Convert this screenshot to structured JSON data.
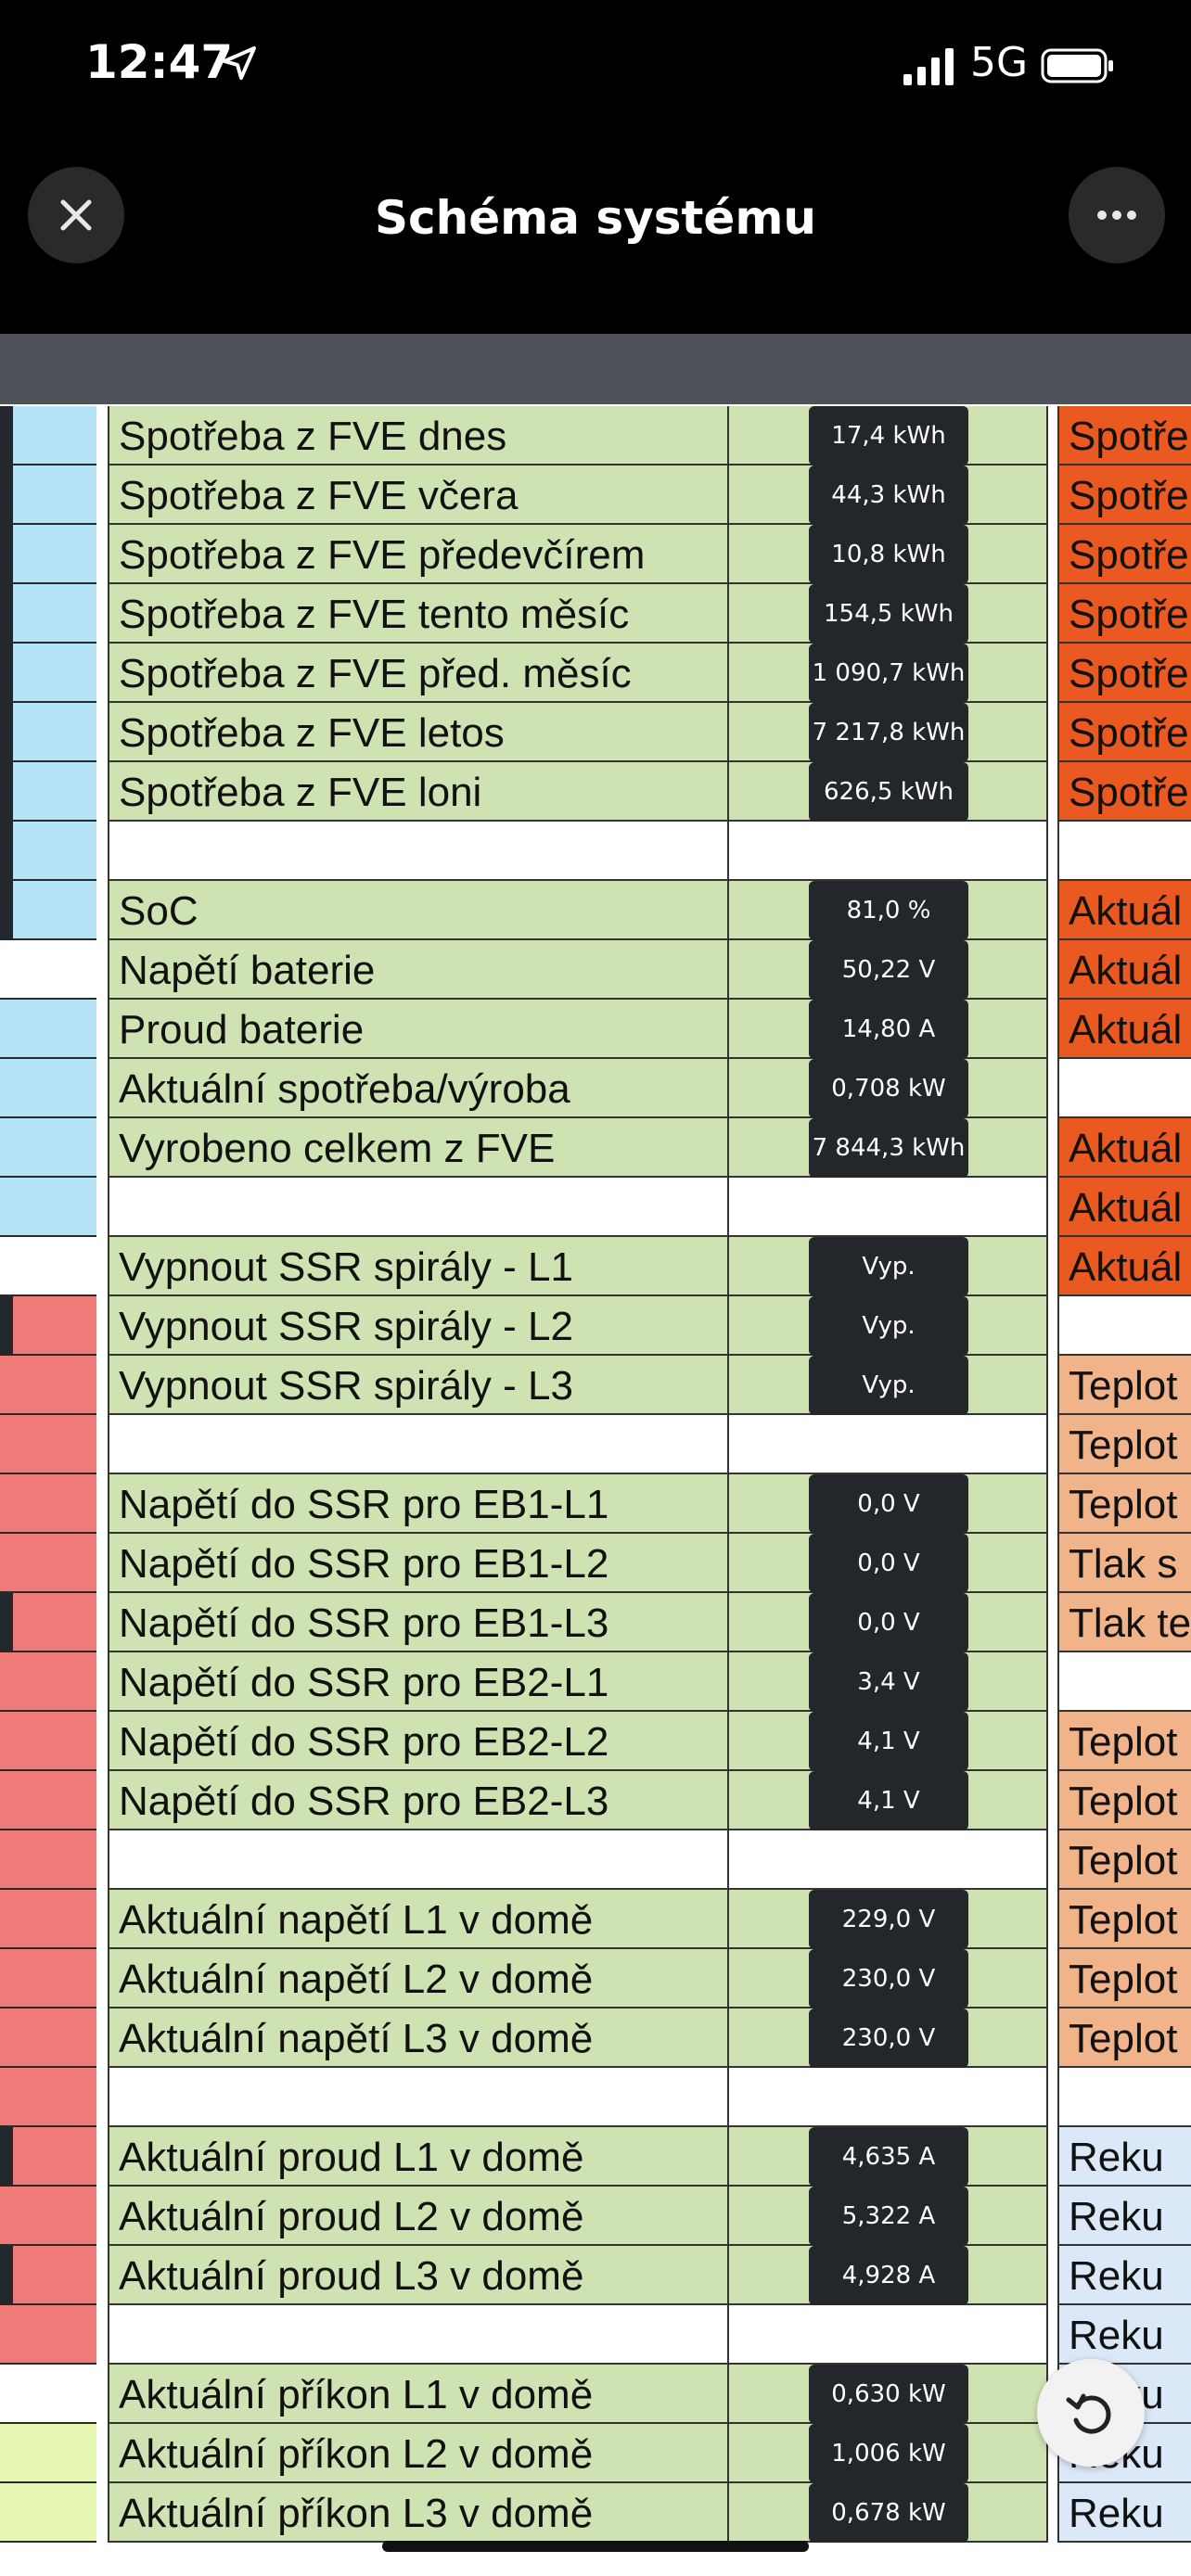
{
  "status_bar": {
    "time": "12:47",
    "network": "5G",
    "location_icon": "location-arrow-icon",
    "signal_icon": "cell-signal-icon",
    "battery_icon": "battery-icon"
  },
  "header": {
    "title": "Schéma systému",
    "close_icon": "close-icon",
    "more_icon": "more-dots-icon"
  },
  "table": {
    "rows": [
      {
        "label": "Spotřeba z FVE dnes",
        "value": "17,4 kWh",
        "left": "blue",
        "right": "Spotře",
        "right_color": "orange"
      },
      {
        "label": "Spotřeba z FVE včera",
        "value": "44,3 kWh",
        "left": "blue",
        "right": "Spotře",
        "right_color": "orange"
      },
      {
        "label": "Spotřeba z FVE předevčírem",
        "value": "10,8 kWh",
        "left": "blue",
        "right": "Spotře",
        "right_color": "orange"
      },
      {
        "label": "Spotřeba z FVE tento měsíc",
        "value": "154,5 kWh",
        "left": "blue",
        "right": "Spotře",
        "right_color": "orange"
      },
      {
        "label": "Spotřeba z FVE před. měsíc",
        "value": "1 090,7 kWh",
        "left": "blue",
        "right": "Spotře",
        "right_color": "orange"
      },
      {
        "label": "Spotřeba z FVE letos",
        "value": "7 217,8 kWh",
        "left": "blue",
        "right": "Spotře",
        "right_color": "orange"
      },
      {
        "label": "Spotřeba z FVE loni",
        "value": "626,5 kWh",
        "left": "blue",
        "right": "Spotře",
        "right_color": "orange"
      },
      {
        "label": "",
        "value": "",
        "left": "blue",
        "right": "",
        "right_color": "white"
      },
      {
        "label": "SoC",
        "value": "81,0 %",
        "left": "blue",
        "right": "Aktuál",
        "right_color": "orange"
      },
      {
        "label": "Napětí baterie",
        "value": "50,22 V",
        "left": "white",
        "right": "Aktuál",
        "right_color": "orange"
      },
      {
        "label": "Proud baterie",
        "value": "14,80 A",
        "left": "blue",
        "right": "Aktuál",
        "right_color": "orange"
      },
      {
        "label": "Aktuální spotřeba/výroba",
        "value": "0,708 kW",
        "left": "blue",
        "right": "",
        "right_color": "white"
      },
      {
        "label": "Vyrobeno celkem z FVE",
        "value": "7 844,3 kWh",
        "left": "blue",
        "right": "Aktuál",
        "right_color": "orange"
      },
      {
        "label": "",
        "value": "",
        "left": "blue",
        "right": "Aktuál",
        "right_color": "orange"
      },
      {
        "label": "Vypnout SSR spirály - L1",
        "value": "Vyp.",
        "left": "white",
        "right": "Aktuál",
        "right_color": "orange"
      },
      {
        "label": "Vypnout SSR spirály - L2",
        "value": "Vyp.",
        "left": "red",
        "right": "",
        "right_color": "white"
      },
      {
        "label": "Vypnout SSR spirály - L3",
        "value": "Vyp.",
        "left": "red",
        "right": "Teplot",
        "right_color": "peach"
      },
      {
        "label": "",
        "value": "",
        "left": "red",
        "right": "Teplot",
        "right_color": "peach"
      },
      {
        "label": "Napětí do SSR pro EB1-L1",
        "value": "0,0 V",
        "left": "red",
        "right": "Teplot",
        "right_color": "peach"
      },
      {
        "label": "Napětí do SSR pro EB1-L2",
        "value": "0,0 V",
        "left": "red",
        "right": "Tlak s",
        "right_color": "peach"
      },
      {
        "label": "Napětí do SSR pro EB1-L3",
        "value": "0,0 V",
        "left": "red",
        "right": "Tlak te",
        "right_color": "peach"
      },
      {
        "label": "Napětí do SSR pro EB2-L1",
        "value": "3,4 V",
        "left": "red",
        "right": "",
        "right_color": "white"
      },
      {
        "label": "Napětí do SSR pro EB2-L2",
        "value": "4,1 V",
        "left": "red",
        "right": "Teplot",
        "right_color": "peach"
      },
      {
        "label": "Napětí do SSR pro EB2-L3",
        "value": "4,1 V",
        "left": "red",
        "right": "Teplot",
        "right_color": "peach"
      },
      {
        "label": "",
        "value": "",
        "left": "red",
        "right": "Teplot",
        "right_color": "peach"
      },
      {
        "label": "Aktuální napětí L1 v domě",
        "value": "229,0 V",
        "left": "red",
        "right": "Teplot",
        "right_color": "peach"
      },
      {
        "label": "Aktuální napětí L2 v domě",
        "value": "230,0 V",
        "left": "red",
        "right": "Teplot",
        "right_color": "peach"
      },
      {
        "label": "Aktuální napětí L3 v domě",
        "value": "230,0 V",
        "left": "red",
        "right": "Teplot",
        "right_color": "peach"
      },
      {
        "label": "",
        "value": "",
        "left": "red",
        "right": "",
        "right_color": "white"
      },
      {
        "label": "Aktuální proud L1 v domě",
        "value": "4,635 A",
        "left": "red",
        "right": "Reku",
        "right_color": "lightblue"
      },
      {
        "label": "Aktuální proud L2 v domě",
        "value": "5,322 A",
        "left": "red",
        "right": "Reku",
        "right_color": "lightblue"
      },
      {
        "label": "Aktuální proud L3 v domě",
        "value": "4,928 A",
        "left": "red",
        "right": "Reku",
        "right_color": "lightblue"
      },
      {
        "label": "",
        "value": "",
        "left": "red",
        "right": "Reku",
        "right_color": "lightblue"
      },
      {
        "label": "Aktuální příkon L1 v domě",
        "value": "0,630 kW",
        "left": "white",
        "right": "Reku",
        "right_color": "lightblue"
      },
      {
        "label": "Aktuální příkon L2 v domě",
        "value": "1,006 kW",
        "left": "lime",
        "right": "Reku",
        "right_color": "lightblue"
      },
      {
        "label": "Aktuální příkon L3 v domě",
        "value": "0,678 kW",
        "left": "lime",
        "right": "Reku",
        "right_color": "lightblue"
      }
    ]
  },
  "refresh_icon": "refresh-icon"
}
